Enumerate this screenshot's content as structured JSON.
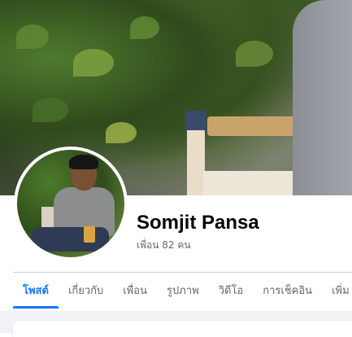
{
  "profile": {
    "name": "Somjit Pansa",
    "friends_label": "เพื่อน 82 คน"
  },
  "tabs": [
    {
      "label": "โพสต์",
      "active": true
    },
    {
      "label": "เกี่ยวกับ",
      "active": false
    },
    {
      "label": "เพื่อน",
      "active": false
    },
    {
      "label": "รูปภาพ",
      "active": false
    },
    {
      "label": "วิดีโอ",
      "active": false
    },
    {
      "label": "การเช็คอิน",
      "active": false
    },
    {
      "label": "เพิ่ม",
      "active": false
    }
  ],
  "colors": {
    "accent": "#1877f2",
    "text_primary": "#050505",
    "text_secondary": "#65676b",
    "feed_background": "#f0f2f5"
  }
}
